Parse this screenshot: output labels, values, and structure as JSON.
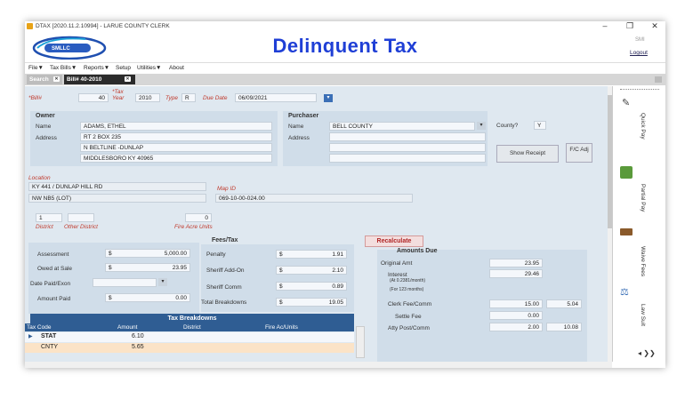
{
  "window": {
    "title": "DTAX [2020.11.2.10994] - LARUE COUNTY CLERK",
    "min": "–",
    "restore": "❐",
    "close": "✕"
  },
  "header": {
    "logo_text": "SMLLC",
    "app_title": "Delinquent Tax",
    "user": "SMI",
    "logout": "Logout"
  },
  "menu": [
    "File▼",
    "Tax Bills▼",
    "Reports▼",
    "Setup",
    "Utilities▼",
    "About"
  ],
  "tabs": {
    "search": "Search",
    "bill": "Bill# 40-2010",
    "close_glyph": "✕"
  },
  "bill": {
    "bill_label": "*Bill#",
    "bill_no": "40",
    "tax_year_label": "*Tax Year",
    "tax_year": "2010",
    "type_label": "Type",
    "type": "R",
    "due_date_label": "Due Date",
    "due_date": "06/09/2021"
  },
  "owner": {
    "title": "Owner",
    "name_label": "Name",
    "name": "ADAMS, ETHEL",
    "address_label": "Address",
    "address1": "RT 2 BOX 235",
    "address2": "N BELTLINE -DUNLAP",
    "address3": "MIDDLESBORO KY 40965"
  },
  "purchaser": {
    "title": "Purchaser",
    "name_label": "Name",
    "name": "BELL COUNTY",
    "address_label": "Address",
    "county_label": "County?",
    "county_value": "Y"
  },
  "buttons": {
    "show_receipt": "Show Receipt",
    "fc_adj": "F/C Adj",
    "recalculate": "Recalculate"
  },
  "location": {
    "label": "Location",
    "line1": "KY 441 / DUNLAP HILL RD",
    "line2": "NW NB5 (LOT)",
    "map_id_label": "Map ID",
    "map_id": "069-10-00-024.00"
  },
  "district": {
    "district": "1",
    "district_label": "District",
    "other_label": "Other District",
    "fire_units": "0",
    "fire_label": "Fire Acre Units"
  },
  "assessment": {
    "assessment_label": "Assessment",
    "assessment_cur": "$",
    "assessment": "5,000.00",
    "owed_label": "Owed at Sale",
    "owed_cur": "$",
    "owed": "23.95",
    "date_paid_label": "Date Paid/Exon",
    "amount_paid_label": "Amount Paid",
    "amount_paid_cur": "$",
    "amount_paid": "0.00"
  },
  "fees": {
    "title": "Fees/Tax",
    "penalty_label": "Penalty",
    "penalty": "1.91",
    "sheriff_addon_label": "Sheriff Add-On",
    "sheriff_addon": "2.10",
    "sheriff_comm_label": "Sheriff Comm",
    "sheriff_comm": "0.89",
    "total_label": "Total Breakdowns",
    "total": "19.05",
    "cur": "$"
  },
  "amounts_due": {
    "title": "Amounts Due",
    "original_label": "Original Amt",
    "original": "23.95",
    "interest_label": "Interest",
    "interest_note1": "(At 0.2381/month)",
    "interest_note2": "(For  123 months)",
    "interest": "29.46",
    "clerk_label": "Clerk Fee/Comm",
    "clerk1": "15.00",
    "clerk2": "5.04",
    "settle_label": "Settle Fee",
    "settle": "0.00",
    "atty_label": "Atty Post/Comm",
    "atty1": "2.00",
    "atty2": "10.08"
  },
  "breakdowns": {
    "title": "Tax Breakdowns",
    "columns": [
      "Tax Code",
      "Amount",
      "District",
      "Fire Ac/Units"
    ],
    "rows": [
      {
        "code": "STAT",
        "amount": "6.10"
      },
      {
        "code": "CNTY",
        "amount": "5.65"
      }
    ]
  },
  "sidebar": [
    "Quick Pay",
    "Partial Pay",
    "Waive Fees",
    "Law Suit"
  ]
}
